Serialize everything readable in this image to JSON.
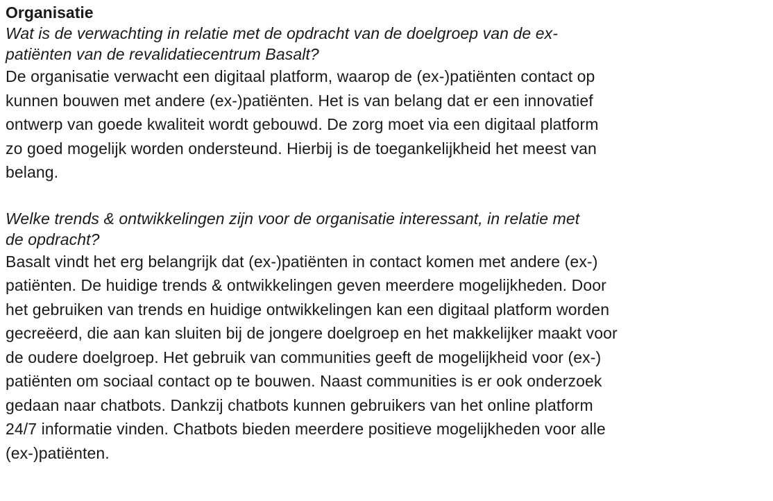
{
  "heading": "Organisatie",
  "section1": {
    "question_lines": [
      "Wat is de verwachting in relatie met de opdracht van de doelgroep van de ex-",
      "patiënten van de revalidatiecentrum Basalt?"
    ],
    "answer_lines": [
      "De organisatie verwacht een digitaal platform, waarop de (ex-)patiënten contact op",
      "kunnen bouwen met andere (ex-)patiënten. Het is van belang dat er een innovatief",
      "ontwerp van goede kwaliteit wordt gebouwd. De zorg moet via een digitaal platform",
      "zo goed mogelijk worden ondersteund. Hierbij is de toegankelijkheid het meest van",
      "belang."
    ]
  },
  "section2": {
    "question_lines": [
      "Welke trends & ontwikkelingen zijn voor de organisatie interessant, in relatie met",
      "de opdracht?"
    ],
    "answer_lines": [
      "Basalt vindt het erg belangrijk dat (ex-)patiënten in contact komen met andere (ex-)",
      "patiënten. De huidige trends & ontwikkelingen geven meerdere mogelijkheden. Door",
      "het gebruiken van trends en huidige ontwikkelingen kan een digitaal platform worden",
      "gecreëerd, die aan kan sluiten bij de jongere doelgroep en het makkelijker maakt voor",
      "de oudere doelgroep. Het gebruik van communities geeft de mogelijkheid voor (ex-)",
      "patiënten om sociaal contact op te bouwen. Naast communities is er ook onderzoek",
      "gedaan naar chatbots. Dankzij chatbots kunnen gebruikers van het online platform",
      "24/7 informatie vinden. Chatbots bieden meerdere positieve mogelijkheden voor alle",
      "(ex-)patiënten."
    ]
  }
}
